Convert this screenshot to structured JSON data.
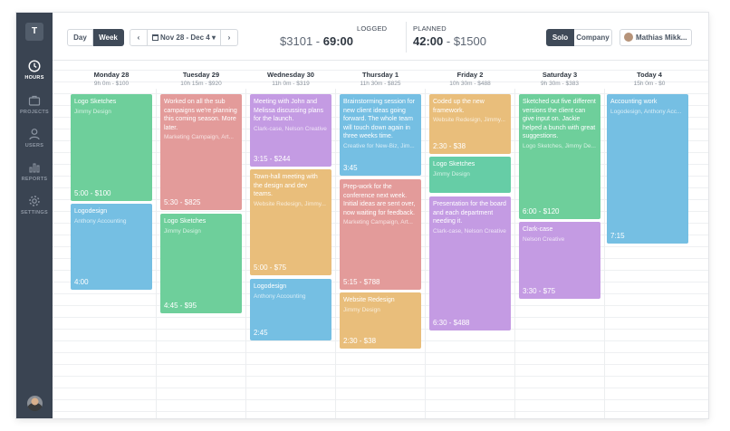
{
  "sidebar": {
    "logo": "T",
    "items": [
      {
        "label": "HOURS",
        "icon": "clock-icon"
      },
      {
        "label": "PROJECTS",
        "icon": "briefcase-icon"
      },
      {
        "label": "USERS",
        "icon": "user-icon"
      },
      {
        "label": "REPORTS",
        "icon": "bar-chart-icon"
      },
      {
        "label": "SETTINGS",
        "icon": "gear-icon"
      }
    ]
  },
  "toolbar": {
    "day": "Day",
    "week": "Week",
    "date_range": "Nov 28 - Dec 4 ▾",
    "prev": "‹",
    "next": "›",
    "logged_label": "LOGGED",
    "logged_amount": "$3101",
    "logged_sep": " - ",
    "logged_hours": "69:00",
    "planned_label": "PLANNED",
    "planned_hours": "42:00",
    "planned_sep": " - ",
    "planned_amount": "$1500",
    "solo": "Solo",
    "company": "Company",
    "user": "Mathias Mikk..."
  },
  "days": [
    {
      "name": "Monday 28",
      "summary": "9h 0m - $100"
    },
    {
      "name": "Tuesday 29",
      "summary": "10h 15m - $920"
    },
    {
      "name": "Wednesday 30",
      "summary": "11h 0m - $319"
    },
    {
      "name": "Thursday 1",
      "summary": "11h 30m - $825"
    },
    {
      "name": "Friday 2",
      "summary": "10h 30m - $488"
    },
    {
      "name": "Saturday 3",
      "summary": "9h 30m - $383"
    },
    {
      "name": "Today 4",
      "summary": "15h 0m - $0"
    }
  ],
  "entries": {
    "mon": [
      {
        "title": "Logo Sketches",
        "sub": "Jimmy Design",
        "foot": "5:00 - $100"
      },
      {
        "title": "Logodesign",
        "sub": "Anthony Accounting",
        "foot": "4:00"
      }
    ],
    "tue": [
      {
        "title": "Worked on all the sub campaigns we're planning this coming season. More later.",
        "sub": "Marketing Campaign, Art...",
        "foot": "5:30 - $825"
      },
      {
        "title": "Logo Sketches",
        "sub": "Jimmy Design",
        "foot": "4:45 - $95"
      }
    ],
    "wed": [
      {
        "title": "Meeting with John and Melissa discussing plans for the launch.",
        "sub": "Clark-case, Nelson Creative",
        "foot": "3:15 - $244"
      },
      {
        "title": "Town-hall meeting with the design and dev teams.",
        "sub": "Website Redesign, Jimmy...",
        "foot": "5:00 - $75"
      },
      {
        "title": "Logodesign",
        "sub": "Anthony Accounting",
        "foot": "2:45"
      }
    ],
    "thu": [
      {
        "title": "Brainstorming session for new client ideas going forward. The whole team will touch down again in three weeks time.",
        "sub": "Creative for New-Biz, Jim...",
        "foot": "3:45"
      },
      {
        "title": "Prep-work for the conference next week. Initial ideas are sent over, now waiting for feedback.",
        "sub": "Marketing Campaign, Art...",
        "foot": "5:15 - $788"
      },
      {
        "title": "Website Redesign",
        "sub": "Jimmy Design",
        "foot": "2:30 - $38"
      }
    ],
    "fri": [
      {
        "title": "Coded up the new framework.",
        "sub": "Website Redesign, Jimmy...",
        "foot": "2:30 - $38"
      },
      {
        "title": "Logo Sketches",
        "sub": "Jimmy Design",
        "foot": ""
      },
      {
        "title": "Presentation for the board and each department needing it.",
        "sub": "Clark-case, Nelson Creative",
        "foot": "6:30 - $488"
      }
    ],
    "sat": [
      {
        "title": "Sketched out five different versions the client can give input on. Jackie helped a bunch with great suggestions.",
        "sub": "Logo Sketches, Jimmy De...",
        "foot": "6:00 - $120"
      },
      {
        "title": "Clark-case",
        "sub": "Nelson Creative",
        "foot": "3:30 - $75"
      }
    ],
    "today": [
      {
        "title": "Accounting work",
        "sub": "Logodesign, Anthony Acc...",
        "foot": "7:15"
      }
    ]
  },
  "colors": {
    "green": "#6ecf9b",
    "red": "#e39b9a",
    "purple": "#c49be3",
    "yellow": "#e9be7b",
    "blue": "#75bfe3",
    "sidebar": "#3a4452"
  }
}
